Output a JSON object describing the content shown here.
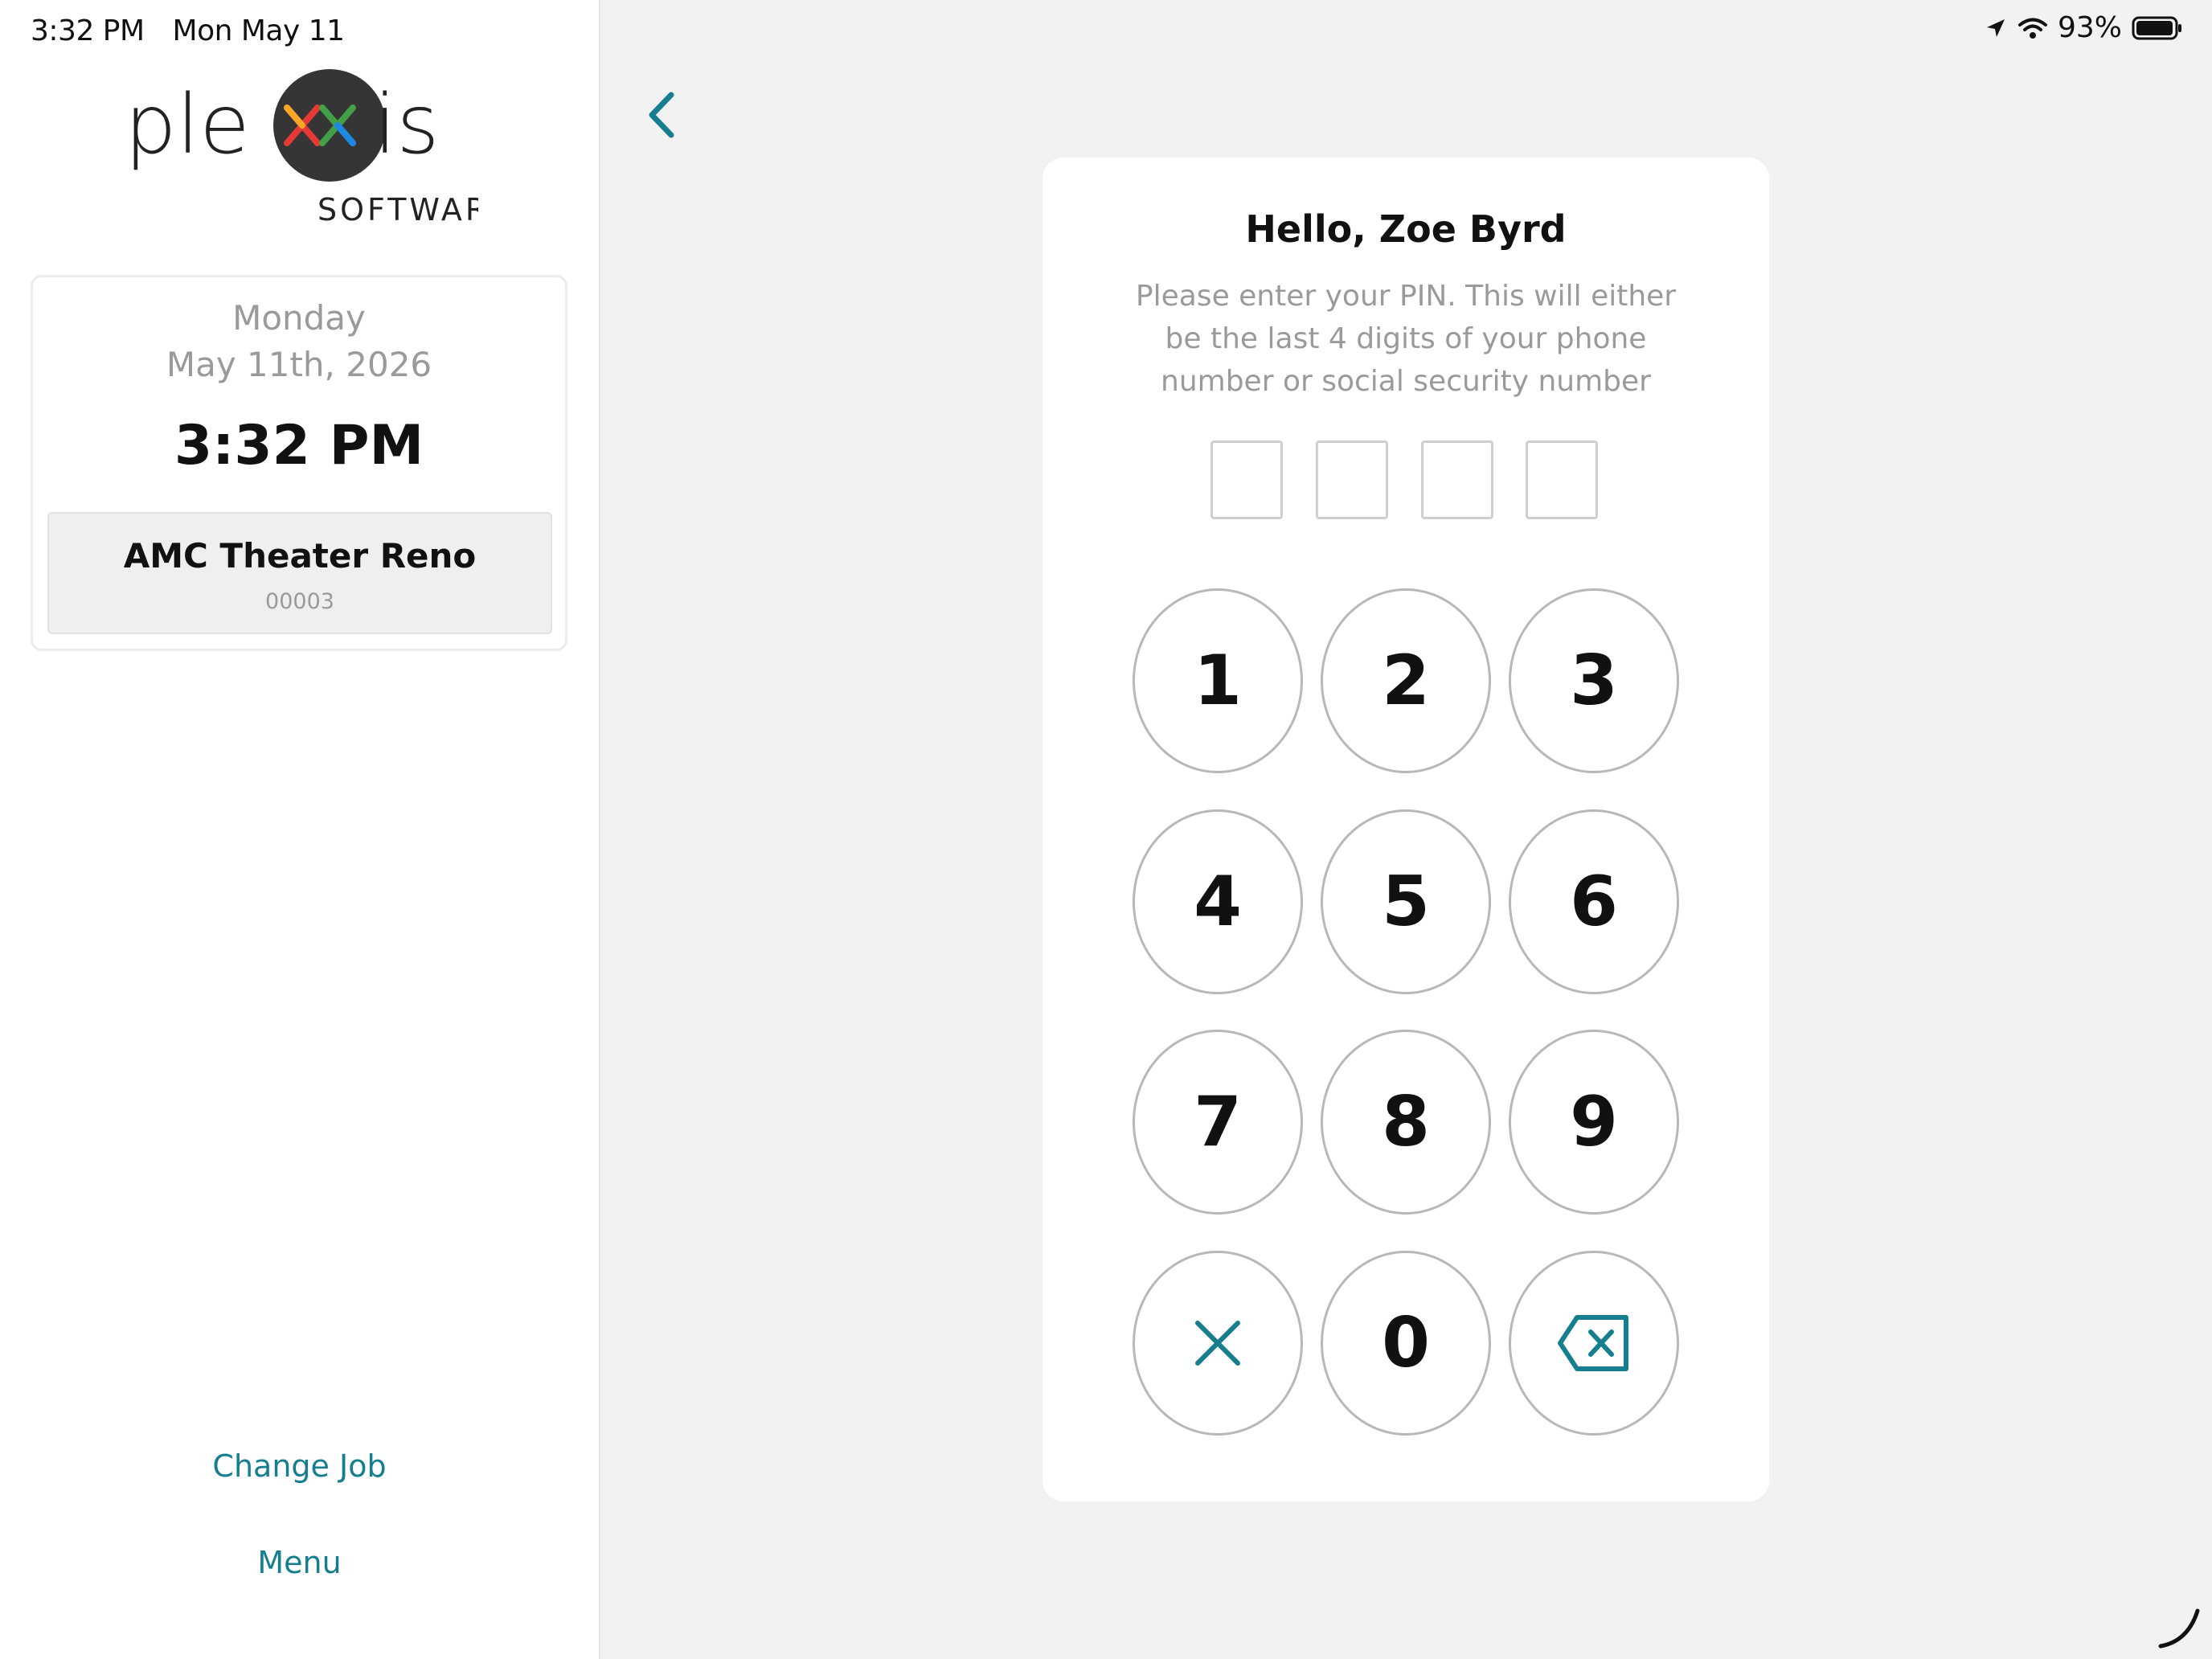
{
  "status_bar": {
    "time": "3:32 PM",
    "date": "Mon May 11",
    "battery": "93%"
  },
  "sidebar": {
    "logo": {
      "text_left": "ple",
      "text_right": "is",
      "subtitle": "SOFTWARE"
    },
    "day_name": "Monday",
    "date": "May 11th, 2026",
    "time": "3:32 PM",
    "location_name": "AMC Theater Reno",
    "location_code": "00003",
    "change_job_label": "Change Job",
    "menu_label": "Menu"
  },
  "pin_pad": {
    "greeting": "Hello, Zoe Byrd",
    "instructions": "Please enter your PIN. This will either be the last 4 digits of your phone number or social security number",
    "keys": [
      "1",
      "2",
      "3",
      "4",
      "5",
      "6",
      "7",
      "8",
      "9",
      "0"
    ]
  },
  "colors": {
    "accent": "#167e8f",
    "background": "#f2f2f2",
    "card": "#ffffff",
    "muted_text": "#9a9a9a"
  },
  "icons": {
    "back": "chevron-left-icon",
    "clear": "close-icon",
    "backspace": "backspace-icon"
  }
}
